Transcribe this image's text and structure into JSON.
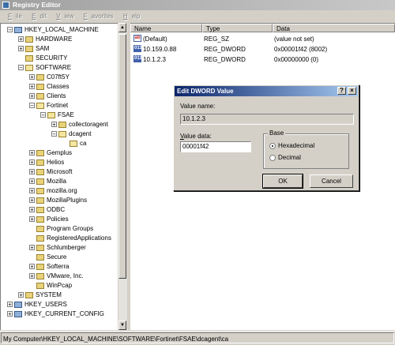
{
  "window": {
    "title": "Registry Editor"
  },
  "menu": {
    "file": "ile",
    "file_key": "F",
    "edit": "dit",
    "edit_key": "E",
    "view": "iew",
    "view_key": "V",
    "favorites": "avorites",
    "favorites_key": "F",
    "help": "elp",
    "help_key": "H"
  },
  "tree": {
    "hklm": "HKEY_LOCAL_MACHINE",
    "hardware": "HARDWARE",
    "sam": "SAM",
    "security": "SECURITY",
    "software": "SOFTWARE",
    "c07": "C07ft5Y",
    "classes": "Classes",
    "clients": "Clients",
    "fortinet": "Fortinet",
    "fsae": "FSAE",
    "collectoragent": "collectoragent",
    "dcagent": "dcagent",
    "ca": "ca",
    "gemplus": "Gemplus",
    "helios": "Helios",
    "microsoft": "Microsoft",
    "mozilla": "Mozilla",
    "mozillaorg": "mozilla.org",
    "mozillaplugins": "MozillaPlugins",
    "odbc": "ODBC",
    "policies": "Policies",
    "programgroups": "Program Groups",
    "regapps": "RegisteredApplications",
    "schlumberger": "Schlumberger",
    "secure": "Secure",
    "softerra": "Softerra",
    "vmware": "VMware, Inc.",
    "winpcap": "WinPcap",
    "system": "SYSTEM",
    "hku": "HKEY_USERS",
    "hkcc": "HKEY_CURRENT_CONFIG"
  },
  "list": {
    "headers": {
      "name": "Name",
      "type": "Type",
      "data": "Data"
    },
    "rows": [
      {
        "name": "(Default)",
        "type": "REG_SZ",
        "data": "(value not set)",
        "icon": "ab"
      },
      {
        "name": "10.159.0.88",
        "type": "REG_DWORD",
        "data": "0x00001f42 (8002)",
        "icon": "011"
      },
      {
        "name": "10.1.2.3",
        "type": "REG_DWORD",
        "data": "0x00000000 (0)",
        "icon": "011"
      }
    ]
  },
  "status": {
    "path": "My Computer\\HKEY_LOCAL_MACHINE\\SOFTWARE\\Fortinet\\FSAE\\dcagent\\ca"
  },
  "dialog": {
    "title": "Edit DWORD Value",
    "help_btn": "?",
    "close_btn": "×",
    "value_name_label": "Value name:",
    "value_name": "10.1.2.3",
    "value_data_label_key": "V",
    "value_data_label": "alue data:",
    "value_data": "00001f42",
    "base_label": "Base",
    "hex_key": "H",
    "hex_label": "exadecimal",
    "dec_key": "D",
    "dec_label": "ecimal",
    "ok": "OK",
    "cancel": "Cancel"
  }
}
